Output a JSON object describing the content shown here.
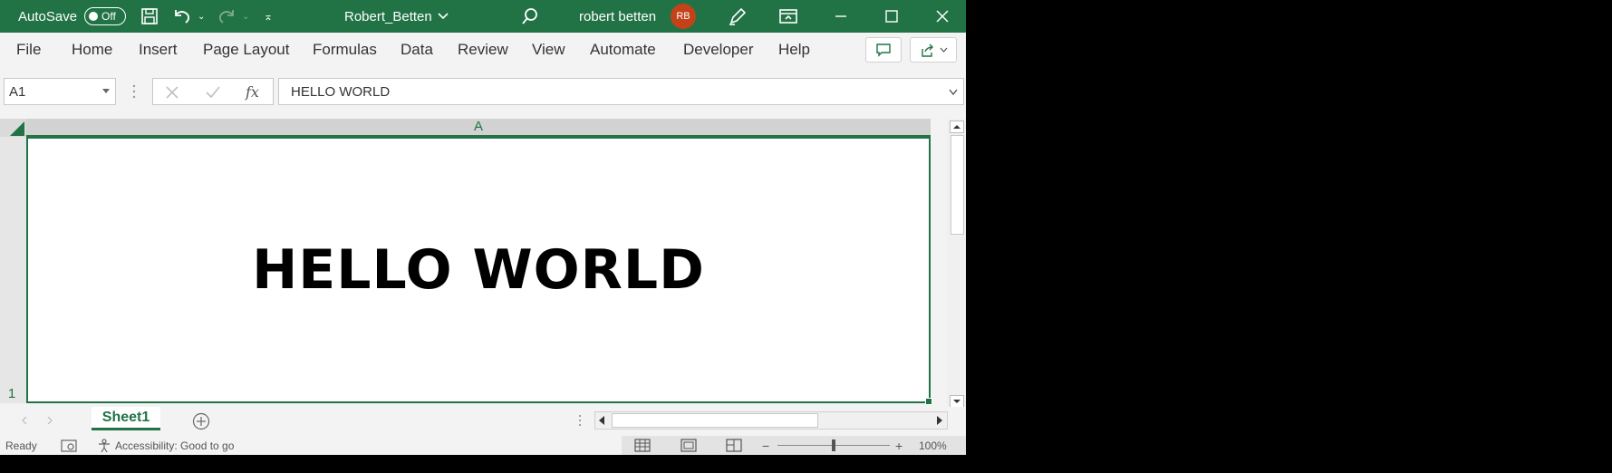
{
  "titlebar": {
    "autosave_label": "AutoSave",
    "autosave_state": "Off",
    "filename": "Robert_Betten",
    "user_name": "robert betten",
    "user_initials": "RB",
    "accent_color": "#217346",
    "avatar_color": "#c4421a"
  },
  "ribbon": {
    "tabs": [
      "File",
      "Home",
      "Insert",
      "Page Layout",
      "Formulas",
      "Data",
      "Review",
      "View",
      "Automate",
      "Developer",
      "Help"
    ]
  },
  "formula_bar": {
    "name_box": "A1",
    "fx_label": "fx",
    "formula": "HELLO WORLD"
  },
  "grid": {
    "column_header": "A",
    "row_header": "1",
    "cell_a1": "HELLO WORLD"
  },
  "sheets": {
    "tabs": [
      "Sheet1"
    ],
    "active": "Sheet1"
  },
  "statusbar": {
    "ready": "Ready",
    "accessibility": "Accessibility: Good to go",
    "zoom": "100%",
    "zoom_minus": "−",
    "zoom_plus": "+"
  }
}
